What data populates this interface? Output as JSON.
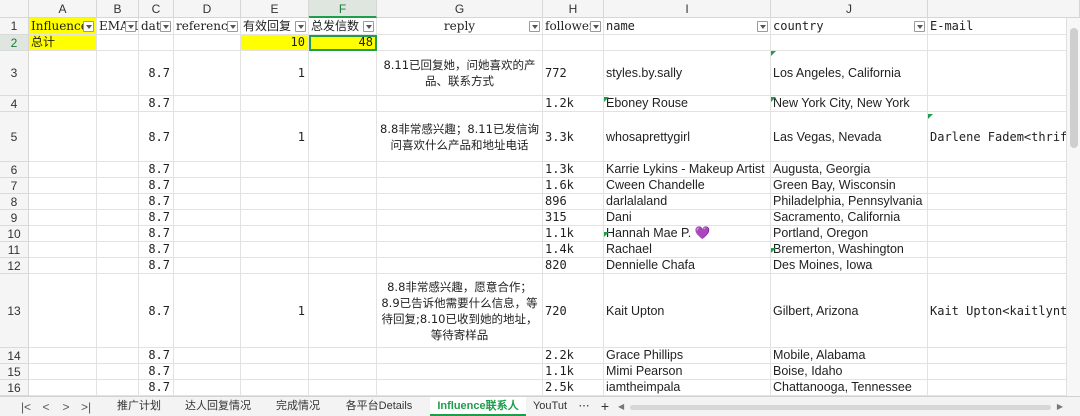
{
  "column_letters": [
    "A",
    "B",
    "C",
    "D",
    "E",
    "F",
    "G",
    "H",
    "I",
    "J",
    ""
  ],
  "active_column": "F",
  "headers": [
    "Influencer",
    "EMAIL",
    "date",
    "reference",
    "有效回复",
    "总发信数",
    "reply",
    "followers",
    "name",
    "country",
    "E-mail"
  ],
  "rows": [
    {
      "num": "2",
      "A": "总计",
      "E": "10",
      "F": "48"
    },
    {
      "num": "3",
      "C": "8.7",
      "E": "1",
      "G": "8.11已回复她，问她喜欢的产品、联系方式",
      "H": "772",
      "I": "styles.by.sally",
      "J": " Los Angeles, California"
    },
    {
      "num": "4",
      "C": "8.7",
      "H": "1.2k",
      "I": "Eboney Rouse",
      "J": " New York City, New York"
    },
    {
      "num": "5",
      "C": "8.7",
      "E": "1",
      "G": "8.8非常感兴趣；8.11已发信询问喜欢什么产品和地址电话",
      "H": "3.3k",
      "I": "whosaprettygirl",
      "J": "Las Vegas, Nevada",
      "K": "Darlene  Fadem<thriftn"
    },
    {
      "num": "6",
      "C": "8.7",
      "H": "1.3k",
      "I": "Karrie Lykins - Makeup Artist",
      "J": "Augusta, Georgia"
    },
    {
      "num": "7",
      "C": "8.7",
      "H": "1.6k",
      "I": "Cween Chandelle",
      "J": "Green Bay, Wisconsin"
    },
    {
      "num": "8",
      "C": "8.7",
      "H": "896",
      "I": "darlalaland",
      "J": "Philadelphia, Pennsylvania"
    },
    {
      "num": "9",
      "C": "8.7",
      "H": "315",
      "I": "Dani",
      "J": "Sacramento, California"
    },
    {
      "num": "10",
      "C": "8.7",
      "H": "1.1k",
      "I": "Hannah Mae P. 💜",
      "J": "Portland, Oregon"
    },
    {
      "num": "11",
      "C": "8.7",
      "H": "1.4k",
      "I": "Rachael",
      "J": " Bremerton, Washington"
    },
    {
      "num": "12",
      "C": "8.7",
      "H": "820",
      "I": "Dennielle Chafa",
      "J": " Des Moines, Iowa"
    },
    {
      "num": "13",
      "C": "8.7",
      "E": "1",
      "G": "8.8非常感兴趣，愿意合作；8.9已告诉他需要什么信息，等待回复;8.10已收到她的地址，等待寄样品",
      "H": "720",
      "I": "Kait Upton",
      "J": "Gilbert, Arizona",
      "K": "Kait  Upton<kaitlynta"
    },
    {
      "num": "14",
      "C": "8.7",
      "H": "2.2k",
      "I": "Grace Phillips",
      "J": "Mobile, Alabama"
    },
    {
      "num": "15",
      "C": "8.7",
      "H": "1.1k",
      "I": "Mimi Pearson",
      "J": "Boise, Idaho"
    },
    {
      "num": "16",
      "C": "8.7",
      "H": "2.5k",
      "I": "iamtheimpala",
      "J": "Chattanooga, Tennessee"
    }
  ],
  "tabs": [
    "推广计划",
    "达人回复情况",
    "完成情况",
    "各平台Details",
    "Influence联系人",
    "YouTut"
  ],
  "active_tab": "Influence联系人",
  "tab_more": "⋯",
  "tab_add": "+",
  "nav_icons": [
    "|<",
    "<",
    ">",
    ">|"
  ],
  "colors": {
    "header_bg": "#f5f5f5",
    "grid": "#e2e2e2",
    "highlight": "#ffff00",
    "accent": "#1e9e4a"
  }
}
